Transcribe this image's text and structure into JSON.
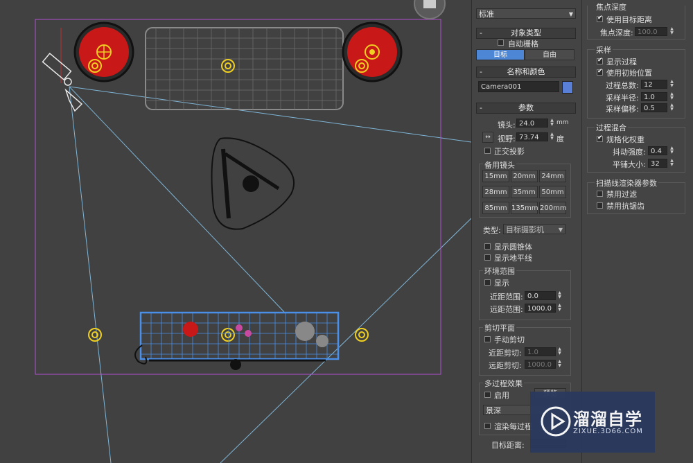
{
  "colors": {
    "accent": "#4c86d4",
    "camera_color": "#5a7fd6",
    "viewport_bg": "#414141",
    "safe_frame": "#b04fd0",
    "light_yellow": "#f0d020"
  },
  "top_dropdown": "标准",
  "object_type": {
    "title": "对象类型",
    "autogrid": "自动栅格",
    "btn_target": "目标",
    "btn_free": "自由"
  },
  "name_color": {
    "title": "名称和颜色",
    "name": "Camera001"
  },
  "params": {
    "title": "参数",
    "lens_label": "镜头:",
    "lens_value": "24.0",
    "lens_unit": "mm",
    "fov_label": "视野:",
    "fov_value": "73.74",
    "fov_unit": "度",
    "ortho": "正交投影",
    "stock_title": "备用镜头",
    "stock": [
      "15mm",
      "20mm",
      "24mm",
      "28mm",
      "35mm",
      "50mm",
      "85mm",
      "135mm",
      "200mm"
    ],
    "type_label": "类型:",
    "type_value": "目标摄影机",
    "show_cone": "显示圆锥体",
    "show_horizon": "显示地平线",
    "env_title": "环境范围",
    "env_show": "显示",
    "near_range_label": "近距范围:",
    "near_range_value": "0.0",
    "far_range_label": "远距范围:",
    "far_range_value": "1000.0",
    "clip_title": "剪切平面",
    "clip_manual": "手动剪切",
    "near_clip_label": "近距剪切:",
    "near_clip_value": "1.0",
    "far_clip_label": "远距剪切:",
    "far_clip_value": "1000.0",
    "multipass_title": "多过程效果",
    "enable": "启用",
    "preview": "预览",
    "effect": "景深",
    "render_each": "渲染每过程",
    "target_dist_label": "目标距离:"
  },
  "dof": {
    "title": "焦点深度",
    "use_target_dist": "使用目标距离",
    "focal_depth_label": "焦点深度:",
    "focal_depth_value": "100.0",
    "sampling_title": "采样",
    "display_passes": "显示过程",
    "use_original": "使用初始位置",
    "total_passes_label": "过程总数:",
    "total_passes_value": "12",
    "sample_radius_label": "采样半径:",
    "sample_radius_value": "1.0",
    "sample_bias_label": "采样偏移:",
    "sample_bias_value": "0.5",
    "blend_title": "过程混合",
    "normalize": "规格化权重",
    "dither_label": "抖动强度:",
    "dither_value": "0.4",
    "tile_label": "平铺大小:",
    "tile_value": "32",
    "scanline_title": "扫描线渲染器参数",
    "disable_filter": "禁用过滤",
    "disable_aa": "禁用抗锯齿"
  },
  "watermark": {
    "title": "溜溜自学",
    "url": "ZIXUE.3D66.COM"
  }
}
